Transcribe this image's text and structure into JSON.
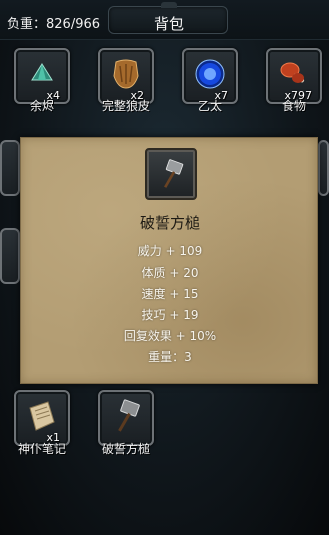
{
  "header": {
    "weight_label": "负重：826/966",
    "title": "背包"
  },
  "grid": {
    "row1": [
      {
        "name": "余烬",
        "count": "x4",
        "icon": "ember-gem-icon"
      },
      {
        "name": "完整狼皮",
        "count": "x2",
        "icon": "wolf-pelt-icon"
      },
      {
        "name": "乙太",
        "count": "x7",
        "icon": "ether-orb-icon"
      },
      {
        "name": "食物",
        "count": "x797",
        "icon": "food-meat-icon"
      }
    ],
    "row4": [
      {
        "name": "神仆笔记",
        "count": "x1",
        "icon": "scroll-note-icon"
      },
      {
        "name": "破誓方槌",
        "count": "",
        "icon": "war-hammer-icon"
      }
    ]
  },
  "popup": {
    "item_name": "破誓方槌",
    "icon": "war-hammer-icon",
    "stats": [
      "威力 + 109",
      "体质 + 20",
      "速度 + 15",
      "技巧 + 19",
      "回复效果 + 10%"
    ],
    "weight": "重量：3"
  },
  "colors": {
    "background": "#0b0f12",
    "slot_border": "#6d7276",
    "popup_parchment": "#b39d73",
    "popup_title_text": "#1d1a14",
    "popup_stat_text": "#f7f4ec"
  }
}
